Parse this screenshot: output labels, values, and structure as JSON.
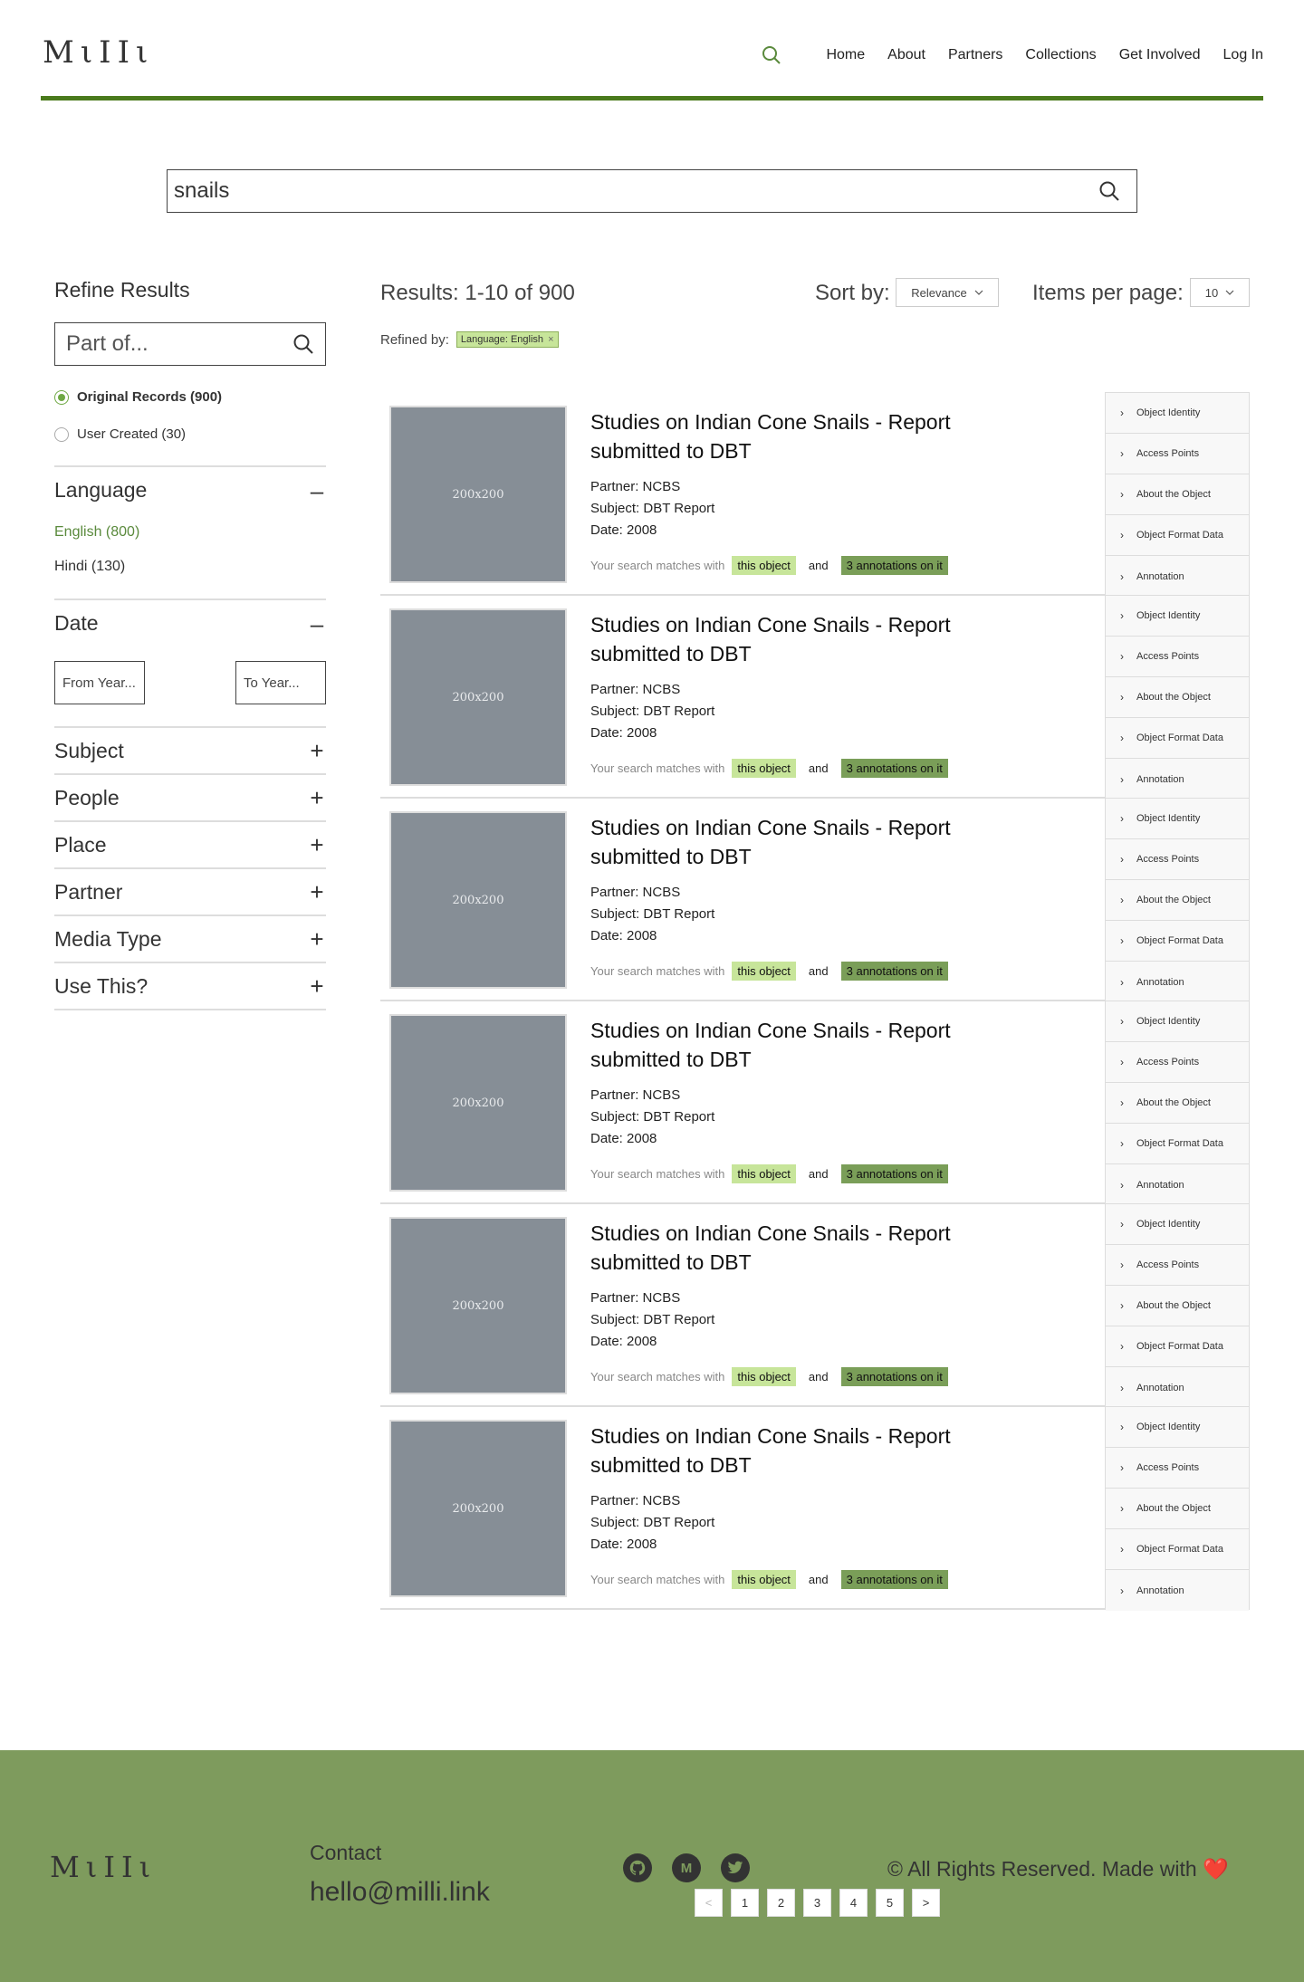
{
  "brand": {
    "logo": "MιIIι"
  },
  "nav": {
    "items": [
      "Home",
      "About",
      "Partners",
      "Collections",
      "Get Involved",
      "Log In"
    ]
  },
  "search": {
    "value": "snails"
  },
  "sidebar": {
    "title": "Refine Results",
    "part_of_placeholder": "Part of...",
    "record_types": [
      {
        "label": "Original Records (900)",
        "selected": true
      },
      {
        "label": "User Created (30)",
        "selected": false
      }
    ],
    "language": {
      "title": "Language",
      "items": [
        {
          "label": "English (800)",
          "selected": true
        },
        {
          "label": "Hindi (130)",
          "selected": false
        }
      ]
    },
    "date": {
      "title": "Date",
      "from_placeholder": "From Year...",
      "to_placeholder": "To Year..."
    },
    "collapsed_facets": [
      "Subject",
      "People",
      "Place",
      "Partner",
      "Media Type",
      "Use This?"
    ],
    "expanded_sign": "–",
    "collapsed_sign": "+"
  },
  "results_header": {
    "count": "Results: 1-10 of 900",
    "sort_label": "Sort by:",
    "sort_value": "Relevance",
    "ipp_label": "Items per page:",
    "ipp_value": "10",
    "refined_label": "Refined by:",
    "refined_tag": "Language: English"
  },
  "results": [
    {
      "thumb": "200x200",
      "title": "Studies on Indian Cone Snails - Report submitted to DBT",
      "partner": "Partner: NCBS",
      "subject": "Subject: DBT Report",
      "date": "Date: 2008",
      "match_text": "Your search matches with",
      "match_object": "this object",
      "match_and": "and",
      "match_annotations": "3 annotations on it"
    },
    {
      "thumb": "200x200",
      "title": "Studies on Indian Cone Snails - Report submitted to DBT",
      "partner": "Partner: NCBS",
      "subject": "Subject: DBT Report",
      "date": "Date: 2008",
      "match_text": "Your search matches with",
      "match_object": "this object",
      "match_and": "and",
      "match_annotations": "3 annotations on it"
    },
    {
      "thumb": "200x200",
      "title": "Studies on Indian Cone Snails - Report submitted to DBT",
      "partner": "Partner: NCBS",
      "subject": "Subject: DBT Report",
      "date": "Date: 2008",
      "match_text": "Your search matches with",
      "match_object": "this object",
      "match_and": "and",
      "match_annotations": "3 annotations on it"
    },
    {
      "thumb": "200x200",
      "title": "Studies on Indian Cone Snails - Report submitted to DBT",
      "partner": "Partner: NCBS",
      "subject": "Subject: DBT Report",
      "date": "Date: 2008",
      "match_text": "Your search matches with",
      "match_object": "this object",
      "match_and": "and",
      "match_annotations": "3 annotations on it"
    },
    {
      "thumb": "200x200",
      "title": "Studies on Indian Cone Snails - Report submitted to DBT",
      "partner": "Partner: NCBS",
      "subject": "Subject: DBT Report",
      "date": "Date: 2008",
      "match_text": "Your search matches with",
      "match_object": "this object",
      "match_and": "and",
      "match_annotations": "3 annotations on it"
    },
    {
      "thumb": "200x200",
      "title": "Studies on Indian Cone Snails - Report submitted to DBT",
      "partner": "Partner: NCBS",
      "subject": "Subject: DBT Report",
      "date": "Date: 2008",
      "match_text": "Your search matches with",
      "match_object": "this object",
      "match_and": "and",
      "match_annotations": "3 annotations on it"
    }
  ],
  "accordion_items": [
    "Object Identity",
    "Access Points",
    "About the Object",
    "Object Format Data",
    "Annotation"
  ],
  "footer": {
    "logo": "MιIIι",
    "contact_label": "Contact",
    "email": "hello@milli.link",
    "social_icons": [
      "github-icon",
      "medium-icon",
      "twitter-icon"
    ],
    "medium_glyph": "M",
    "copyright": "© All Rights Reserved. Made with",
    "heart": "❤️"
  },
  "pagination": {
    "prev": "<",
    "pages": [
      "1",
      "2",
      "3",
      "4",
      "5"
    ],
    "next": ">"
  },
  "colors": {
    "accent": "#4a7a1c",
    "footer_bg": "#7e9b5d",
    "highlight_light": "#c7e59a",
    "highlight_dark": "#7a9e58"
  }
}
